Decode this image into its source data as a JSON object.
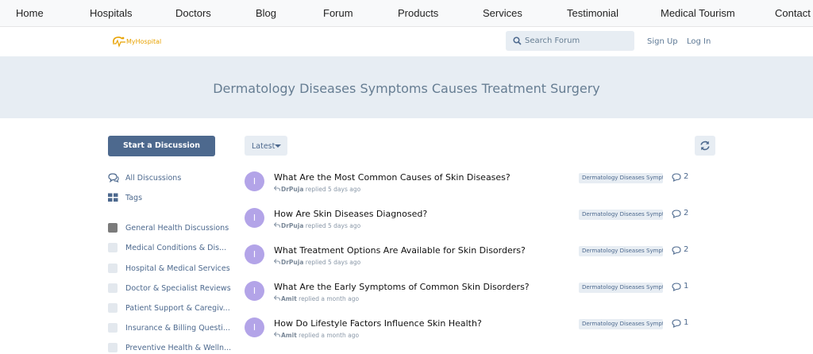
{
  "topnav": [
    "Home",
    "Hospitals",
    "Doctors",
    "Blog",
    "Forum",
    "Products",
    "Services",
    "Testimonial",
    "Medical Tourism",
    "Contact"
  ],
  "header": {
    "logo_text": "MyHospital",
    "search_placeholder": "Search Forum",
    "sign_up": "Sign Up",
    "log_in": "Log In"
  },
  "hero": {
    "title": "Dermatology Diseases Symptoms Causes Treatment Surgery"
  },
  "sidebar": {
    "start_button": "Start a Discussion",
    "nav": [
      {
        "label": "All Discussions",
        "icon": "comments-icon"
      },
      {
        "label": "Tags",
        "icon": "tags-grid-icon"
      }
    ],
    "tags": [
      "General Health Discussions",
      "Medical Conditions & Dis...",
      "Hospital & Medical Services",
      "Doctor & Specialist Reviews",
      "Patient Support & Caregiv...",
      "Insurance & Billing Questi...",
      "Preventive Health & Welln..."
    ]
  },
  "toolbar": {
    "sort_label": "Latest"
  },
  "discussions": [
    {
      "avatar": "I",
      "title": "What Are the Most Common Causes of Skin Diseases?",
      "user": "DrPuja",
      "when": "replied 5 days ago",
      "tag": "Dermatology Diseases Symptoms",
      "replies": "2"
    },
    {
      "avatar": "I",
      "title": "How Are Skin Diseases Diagnosed?",
      "user": "DrPuja",
      "when": "replied 5 days ago",
      "tag": "Dermatology Diseases Symptoms",
      "replies": "2"
    },
    {
      "avatar": "I",
      "title": "What Treatment Options Are Available for Skin Disorders?",
      "user": "DrPuja",
      "when": "replied 5 days ago",
      "tag": "Dermatology Diseases Symptoms",
      "replies": "2"
    },
    {
      "avatar": "I",
      "title": "What Are the Early Symptoms of Common Skin Disorders?",
      "user": "Amit",
      "when": "replied a month ago",
      "tag": "Dermatology Diseases Symptoms",
      "replies": "1"
    },
    {
      "avatar": "I",
      "title": "How Do Lifestyle Factors Influence Skin Health?",
      "user": "Amit",
      "when": "replied a month ago",
      "tag": "Dermatology Diseases Symptoms",
      "replies": "1"
    }
  ],
  "colors": {
    "accent": "#4d698e",
    "hero_bg": "#e7edf3",
    "avatar": "#b3a4e8",
    "logo": "#e8a200"
  }
}
